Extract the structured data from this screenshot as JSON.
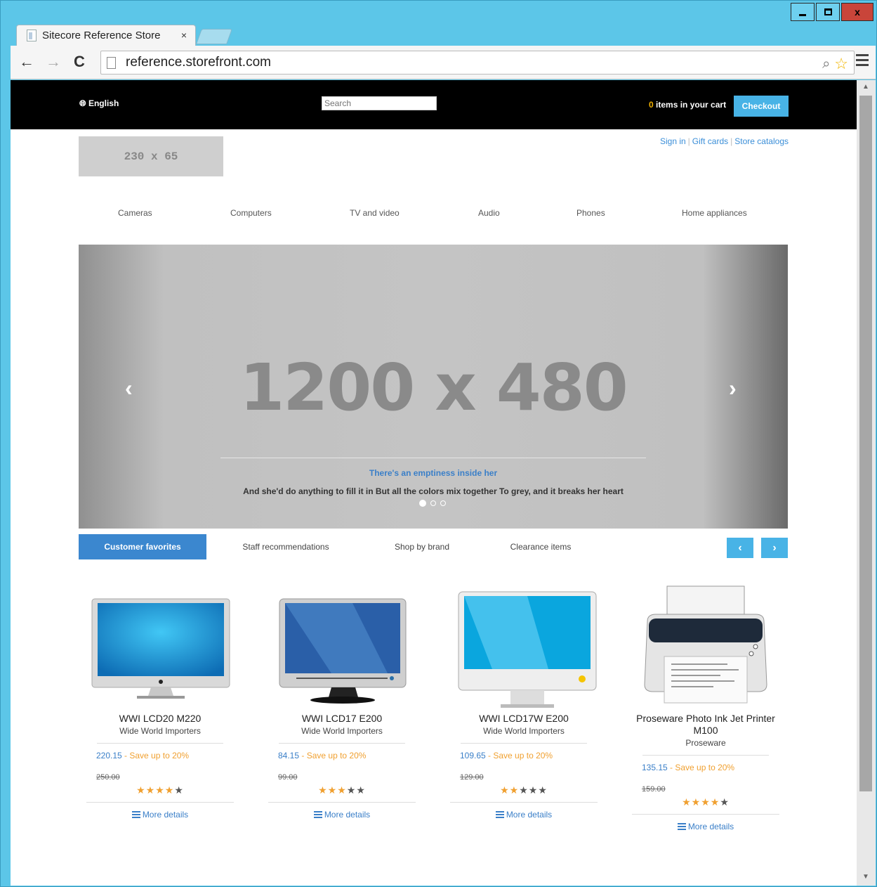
{
  "browser": {
    "tab_title": "Sitecore Reference Store",
    "tab_close": "×",
    "url": "reference.storefront.com",
    "close_label": "x"
  },
  "header": {
    "language": "English",
    "search_placeholder": "Search",
    "cart_count": "0",
    "cart_text": "items in your cart",
    "checkout_label": "Checkout"
  },
  "logo_text": "230 x 65",
  "top_links": [
    "Sign in",
    "Gift cards",
    "Store catalogs"
  ],
  "categories": [
    "Cameras",
    "Computers",
    "TV and video",
    "Audio",
    "Phones",
    "Home appliances"
  ],
  "hero": {
    "placeholder": "1200 x 480",
    "caption_title": "There's an emptiness inside her",
    "caption_text": "And she'd do anything to fill it in But all the colors mix together To grey, and it breaks her heart",
    "slide_count": 3,
    "active_slide": 1
  },
  "product_tabs": [
    "Customer favorites",
    "Staff recommendations",
    "Shop by brand",
    "Clearance items"
  ],
  "product_tab_active": "Customer favorites",
  "products": [
    {
      "name": "WWI LCD20 M220",
      "brand": "Wide World Importers",
      "price": "220.15",
      "save": "Save up to 20%",
      "old_price": "250.00",
      "rating": 4,
      "more": "More details"
    },
    {
      "name": "WWI LCD17 E200",
      "brand": "Wide World Importers",
      "price": "84.15",
      "save": "Save up to 20%",
      "old_price": "99.00",
      "rating": 3,
      "more": "More details"
    },
    {
      "name": "WWI LCD17W E200",
      "brand": "Wide World Importers",
      "price": "109.65",
      "save": "Save up to 20%",
      "old_price": "129.00",
      "rating": 2,
      "more": "More details"
    },
    {
      "name": "Proseware Photo Ink Jet Printer M100",
      "brand": "Proseware",
      "price": "135.15",
      "save": "Save up to 20%",
      "old_price": "159.00",
      "rating": 4,
      "more": "More details"
    }
  ],
  "colors": {
    "accent": "#48b3e6",
    "active_tab": "#3b87cf",
    "link": "#3a7fc8",
    "star": "#f0a030"
  }
}
